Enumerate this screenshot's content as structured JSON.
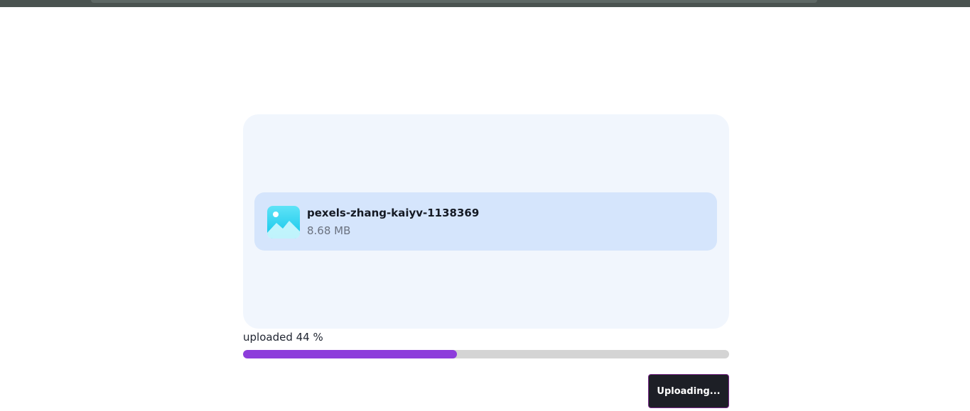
{
  "file": {
    "name": "pexels-zhang-kaiyv-1138369",
    "size": "8.68 MB",
    "icon": "image-icon"
  },
  "progress": {
    "label": "uploaded 44 %",
    "percent": 44
  },
  "upload_button": {
    "label": "Uploading..."
  },
  "colors": {
    "dropzone_bg": "#f1f6fd",
    "file_card_bg": "#d5e5fc",
    "progress_fill": "#8d3ddb",
    "progress_track": "#d4d4d4",
    "button_bg": "#1d1f26",
    "button_border": "#7b2a8c"
  }
}
